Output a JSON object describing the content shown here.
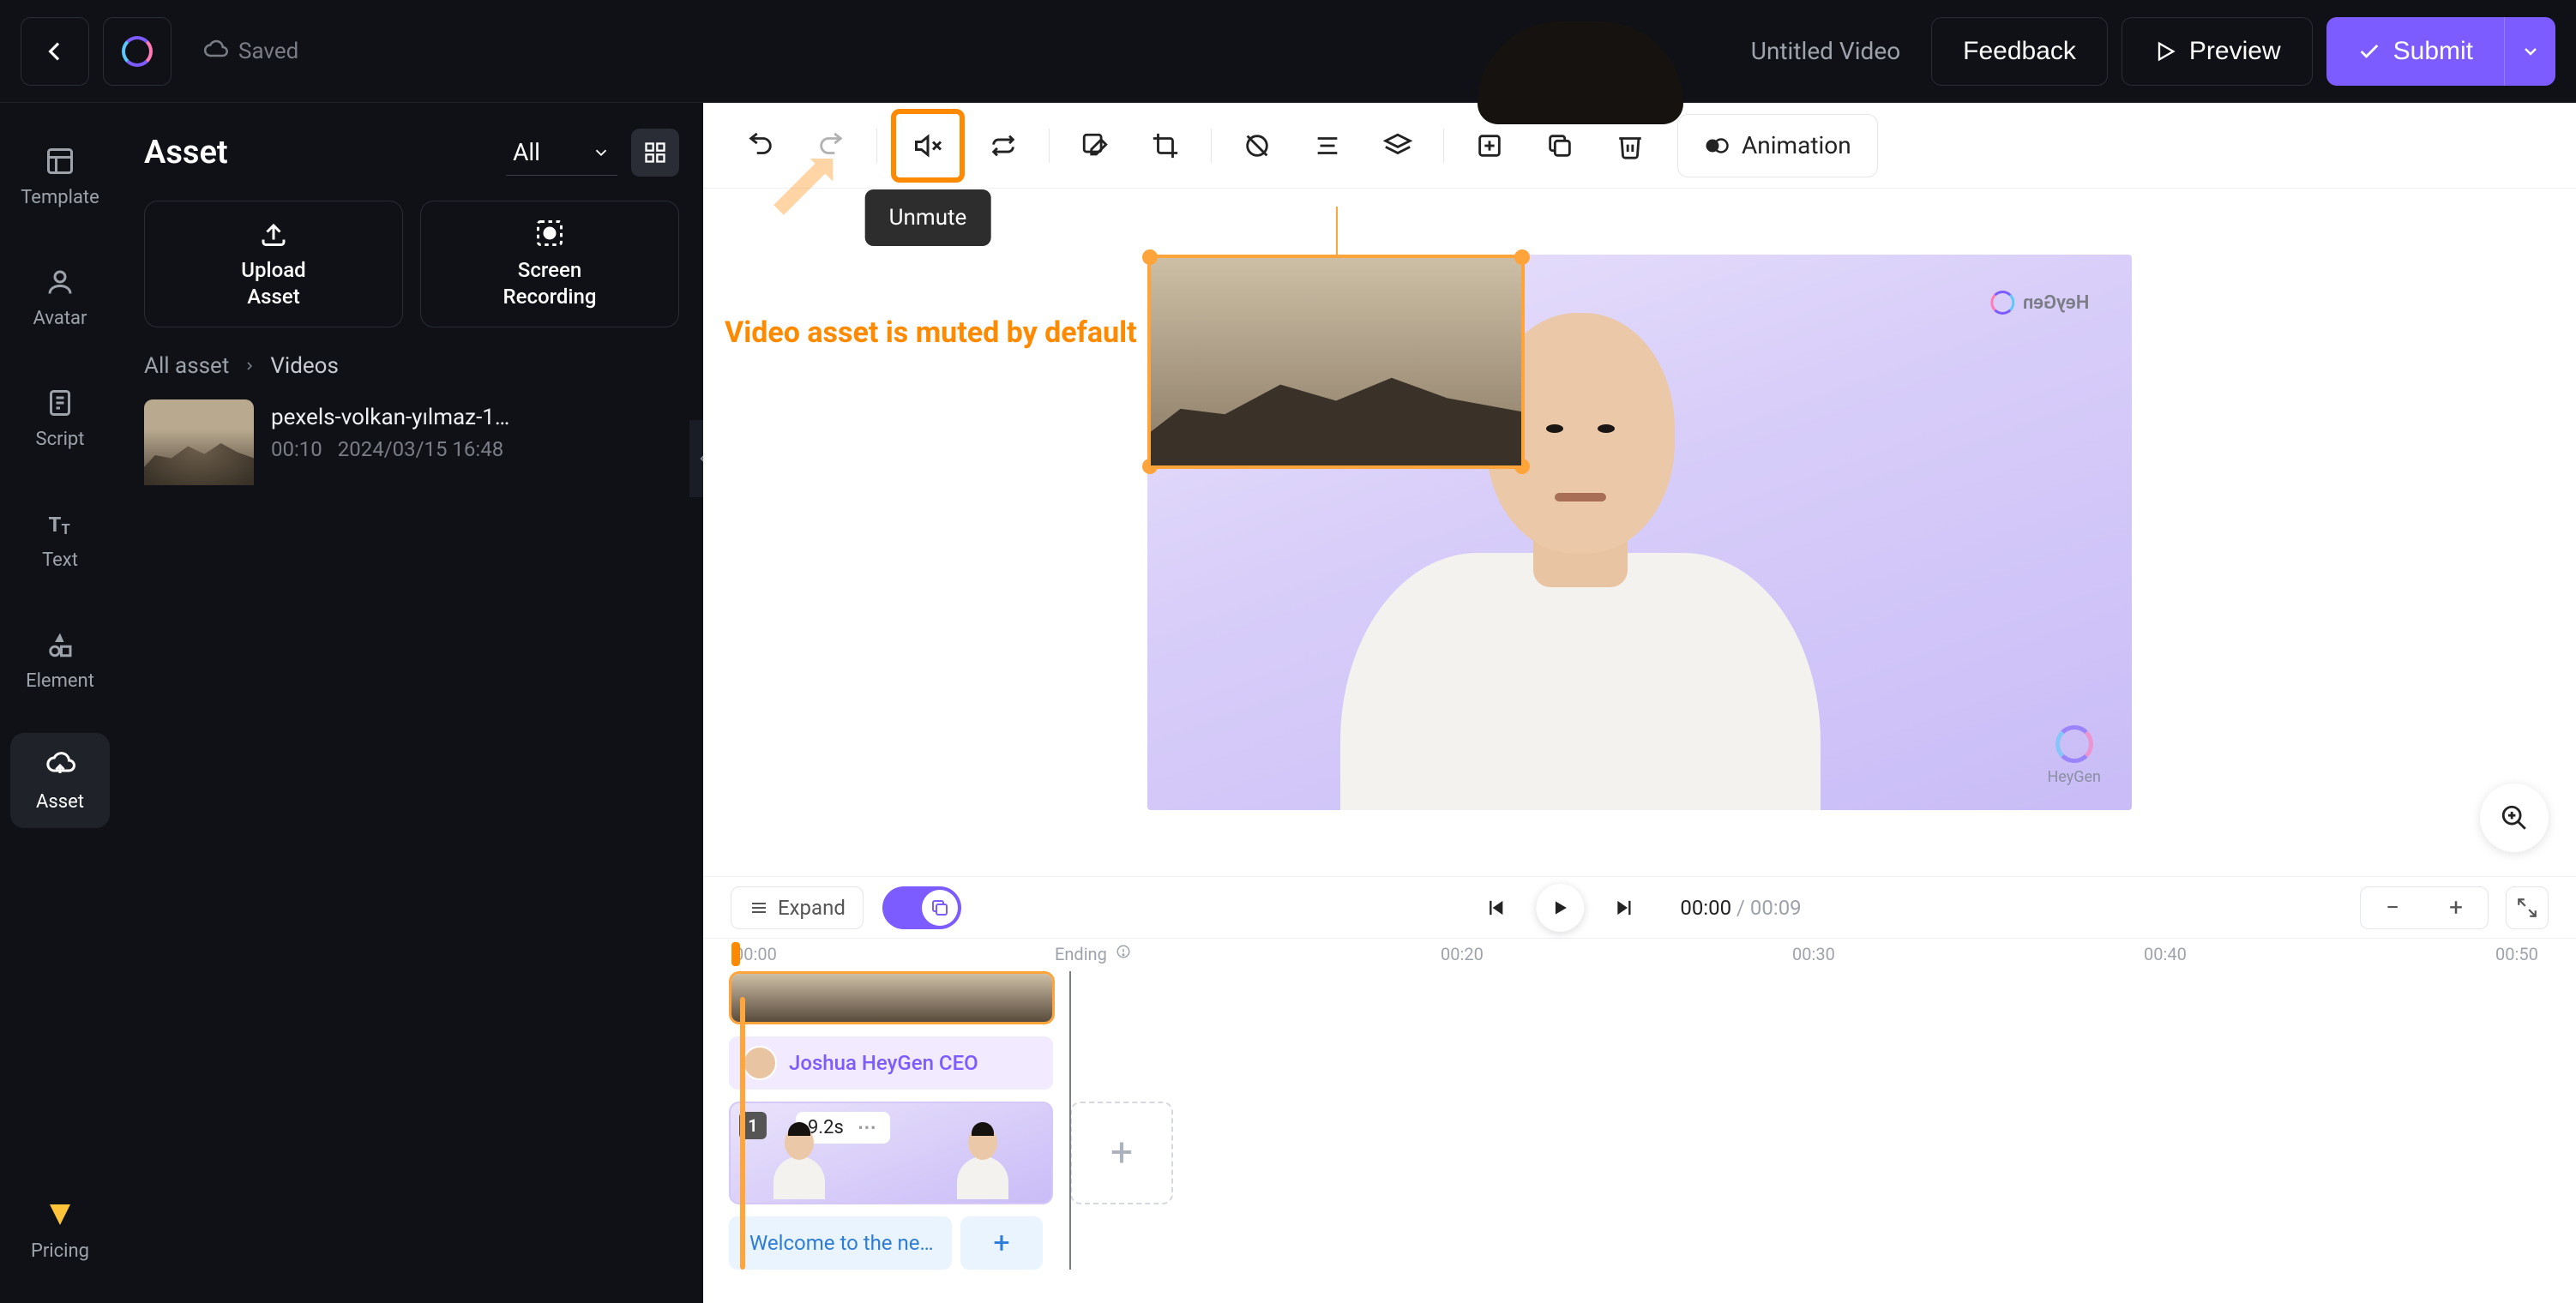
{
  "topbar": {
    "saved": "Saved",
    "video_title": "Untitled Video",
    "feedback": "Feedback",
    "preview": "Preview",
    "submit": "Submit"
  },
  "rail": {
    "template": "Template",
    "avatar": "Avatar",
    "script": "Script",
    "text": "Text",
    "element": "Element",
    "asset": "Asset",
    "pricing": "Pricing"
  },
  "asset_panel": {
    "title": "Asset",
    "filter": "All",
    "upload_asset": "Upload\nAsset",
    "screen_recording": "Screen\nRecording",
    "crumb_root": "All asset",
    "crumb_current": "Videos",
    "item": {
      "name": "pexels-volkan-yılmaz-1…",
      "duration": "00:10",
      "date": "2024/03/15 16:48"
    }
  },
  "toolbar": {
    "tooltip": "Unmute",
    "animation": "Animation"
  },
  "annotation": {
    "mute_default": "Video asset is muted by default"
  },
  "canvas": {
    "watermark_text": "HeyGen",
    "watermark_small": "HeyGen"
  },
  "timeline": {
    "expand": "Expand",
    "time_current": "00:00",
    "time_total": "00:09",
    "ruler": {
      "r0": "00:00",
      "ending": "Ending",
      "r20": "00:20",
      "r30": "00:30",
      "r40": "00:40",
      "r50": "00:50"
    },
    "avatar_track": "Joshua HeyGen CEO",
    "scene": {
      "number": "1",
      "duration": "9.2s"
    },
    "caption": "Welcome to the ne…"
  }
}
